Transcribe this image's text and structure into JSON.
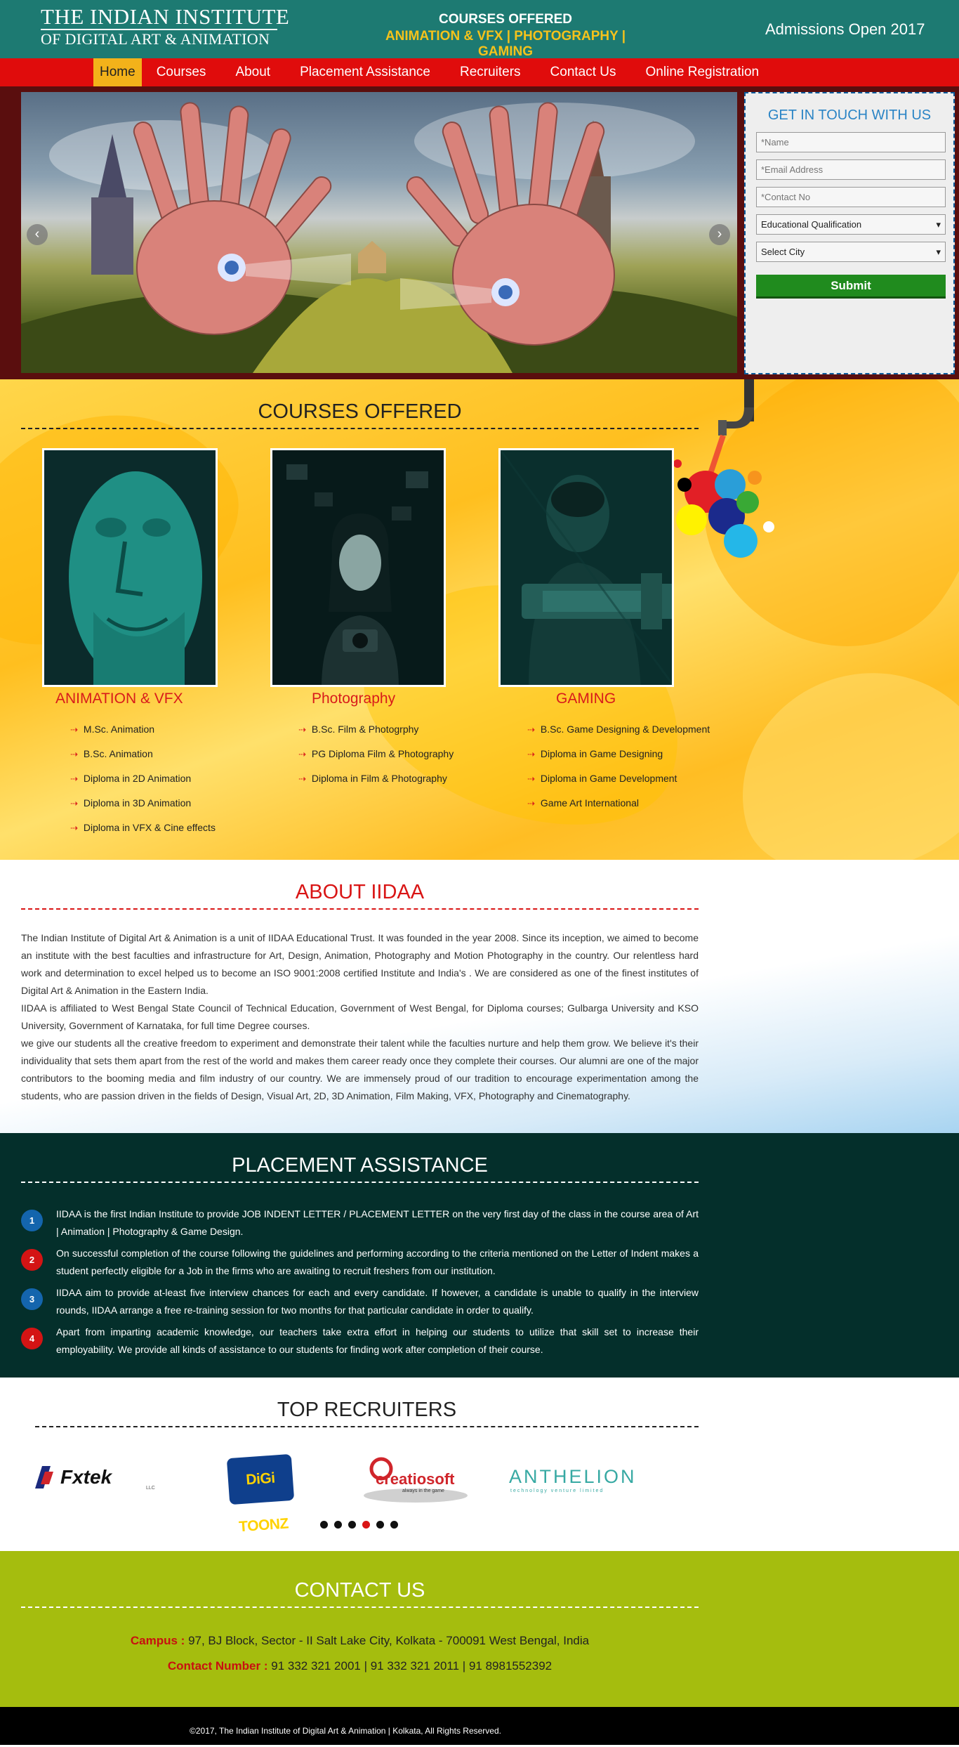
{
  "header": {
    "logo_line1": "THE INDIAN INSTITUTE",
    "logo_line2": "OF DIGITAL ART & ANIMATION",
    "courses_title": "COURSES OFFERED",
    "courses_subtitle": "ANIMATION & VFX | PHOTOGRAPHY | GAMING",
    "admissions": "Admissions Open 2017"
  },
  "nav": {
    "items": [
      "Home",
      "Courses",
      "About",
      "Placement Assistance",
      "Recruiters",
      "Contact Us",
      "Online Registration"
    ]
  },
  "banner": {
    "prev_icon": "‹",
    "next_icon": "›"
  },
  "contact_form": {
    "title": "GET IN TOUCH WITH US",
    "name_placeholder": "*Name",
    "email_placeholder": "*Email Address",
    "contact_placeholder": "*Contact No",
    "qualification_selected": "Educational Qualification",
    "city_selected": "Select City",
    "submit_label": "Submit"
  },
  "courses": {
    "title": "COURSES OFFERED",
    "bullet": "⇢",
    "cards": [
      {
        "name": "ANIMATION & VFX",
        "items": [
          "M.Sc. Animation",
          "B.Sc. Animation",
          "Diploma in 2D Animation",
          "Diploma in 3D Animation",
          "Diploma in VFX & Cine effects"
        ]
      },
      {
        "name": "Photography",
        "items": [
          "B.Sc. Film & Photogrphy",
          "PG Diploma Film & Photography",
          "Diploma in Film & Photography"
        ]
      },
      {
        "name": "GAMING",
        "items": [
          "B.Sc. Game Designing & Development",
          "Diploma in Game Designing",
          "Diploma in Game Development",
          "Game Art International"
        ]
      }
    ]
  },
  "about": {
    "title": "ABOUT IIDAA",
    "p1": "The Indian Institute of Digital Art & Animation is a unit of IIDAA Educational Trust. It was founded in the year 2008. Since its inception, we aimed to become an institute with the best faculties and infrastructure for Art, Design, Animation, Photography and Motion Photography in the country. Our relentless hard work and determination to excel helped us to become an ISO 9001:2008 certified Institute and India's . We are considered as one of the finest institutes of Digital Art & Animation in the Eastern India.",
    "p2": "IIDAA is affiliated to West Bengal State Council of Technical Education, Government of West Bengal, for Diploma courses; Gulbarga University and KSO University, Government of Karnataka, for full time Degree courses.",
    "p3": "we give our students all the creative freedom to experiment and demonstrate their talent while the faculties nurture and help them grow. We believe it's their individuality that sets them apart from the rest of the world and makes them career ready once they complete their courses. Our alumni are one of the major contributors to the booming media and film industry of our country. We are immensely proud of our tradition to encourage experimentation among the students, who are passion driven in the fields of Design, Visual Art, 2D, 3D Animation, Film Making, VFX, Photography and Cinematography."
  },
  "placement": {
    "title": "PLACEMENT ASSISTANCE",
    "items": [
      {
        "num": "1",
        "color": "#1465ad",
        "text": "IIDAA is the first Indian Institute to provide JOB INDENT LETTER / PLACEMENT LETTER on the very first day of the class in the course area of Art | Animation | Photography & Game Design."
      },
      {
        "num": "2",
        "color": "#d41414",
        "text": "On successful completion of the course following the guidelines and performing according to the criteria mentioned on the Letter of Indent makes a student perfectly eligible for a Job in the firms who are awaiting to recruit freshers from our institution."
      },
      {
        "num": "3",
        "color": "#1465ad",
        "text": "IIDAA aim to provide at-least five interview chances for each and every candidate. If however, a candidate is unable to qualify in the interview rounds, IIDAA arrange a free re-training session for two months for that particular candidate in order to qualify."
      },
      {
        "num": "4",
        "color": "#d41414",
        "text": "Apart from imparting academic knowledge, our teachers take extra effort in helping our students to utilize that skill set to increase their employability. We provide all kinds of assistance to our students for finding work after completion of their course."
      }
    ]
  },
  "recruiters": {
    "title": "TOP RECRUITERS",
    "logos": [
      {
        "name": "Fxtek",
        "tagline": "LLC"
      },
      {
        "name": "DiGi TOONZ"
      },
      {
        "name": "creatiosoft",
        "tagline": "always in the game"
      },
      {
        "name": "ANTHELION",
        "tagline": "technology venture limited"
      }
    ],
    "active_dot": 3,
    "dot_count": 6
  },
  "contact": {
    "title": "CONTACT US",
    "campus_label": "Campus :",
    "campus_value": "97, BJ Block, Sector - II Salt Lake City, Kolkata - 700091 West Bengal, India",
    "number_label": "Contact Number :",
    "number_value": "91 332 321 2001 | 91 332 321 2011 | 91 8981552392"
  },
  "footer": {
    "text": "©2017, The Indian Institute of Digital Art & Animation | Kolkata, All Rights Reserved."
  },
  "colors": {
    "header_teal": "#1d7a72",
    "nav_red": "#e00c0c",
    "nav_active": "#f3b21a",
    "accent_red": "#d91515",
    "placement_bg": "#042f2b",
    "contact_green": "#a5bd0e",
    "submit_green": "#208b1e"
  }
}
